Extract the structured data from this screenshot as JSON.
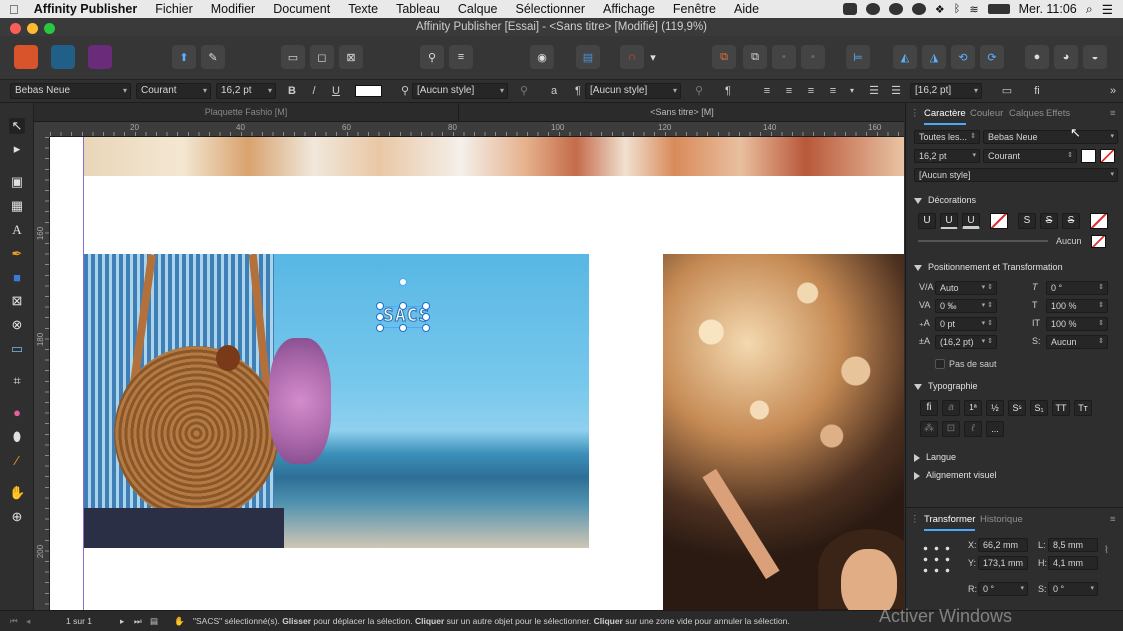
{
  "menubar": {
    "apple": "",
    "app_name": "Affinity Publisher",
    "items": [
      "Fichier",
      "Modifier",
      "Document",
      "Texte",
      "Tableau",
      "Calque",
      "Sélectionner",
      "Affichage",
      "Fenêtre",
      "Aide"
    ],
    "clock": "Mer. 11:06"
  },
  "window": {
    "title": "Affinity Publisher [Essai] - <Sans titre> [Modifié] (119,9%)"
  },
  "context_toolbar": {
    "font_family": "Bebas Neue",
    "font_style": "Courant",
    "font_size": "16,2 pt",
    "bold": "B",
    "italic": "/",
    "underline": "U",
    "char_style": "[Aucun style]",
    "char_a": "a",
    "pilcrow": "¶",
    "para_style": "[Aucun style]",
    "pilcrow2": "¶",
    "leading": "[16,2 pt]",
    "fi": "fi"
  },
  "doc_tabs": [
    "Plaquette Fashio [M]",
    "<Sans titre> [M]"
  ],
  "rulers": {
    "h_labels": [
      "20",
      "40",
      "60",
      "80",
      "100",
      "120",
      "140",
      "160"
    ],
    "v_labels": [
      "160",
      "180",
      "200"
    ]
  },
  "canvas": {
    "selected_text": "SACS"
  },
  "panel_tabs": [
    "Caractère",
    "Couleur",
    "Calques",
    "Effets"
  ],
  "character": {
    "scope": "Toutes les...",
    "font": "Bebas Neue",
    "size": "16,2 pt",
    "style": "Courant",
    "char_style": "[Aucun style]"
  },
  "decorations": {
    "title": "Décorations",
    "btns": [
      "U",
      "U",
      "U",
      "S",
      "S",
      "S"
    ],
    "line_value": "Aucun"
  },
  "position": {
    "title": "Positionnement et Transformation",
    "fields": [
      "Auto",
      "0 °",
      "0 ‰",
      "100 %",
      "0 pt",
      "100 %",
      "(16,2 pt)",
      "Aucun"
    ],
    "no_break": "Pas de saut"
  },
  "typography": {
    "title": "Typographie",
    "btns": [
      "fi",
      "a",
      "1ª",
      "½",
      "Sˢ",
      "S₁",
      "TT",
      "Tт"
    ],
    "more": "..."
  },
  "sections": {
    "langue": "Langue",
    "alignement": "Alignement visuel"
  },
  "transform_tabs": [
    "Transformer",
    "Historique"
  ],
  "transform": {
    "x_label": "X:",
    "x": "66,2 mm",
    "y_label": "Y:",
    "y": "173,1 mm",
    "l_label": "L:",
    "l": "8,5 mm",
    "h_label": "H:",
    "h": "4,1 mm",
    "r_label": "R:",
    "r": "0 °",
    "s_label": "S:",
    "s": "0 °"
  },
  "status": {
    "page": "1 sur 1",
    "msg1": "\"SACS\" sélectionné(s). ",
    "b1": "Glisser",
    "msg2": " pour déplacer la sélection. ",
    "b2": "Cliquer",
    "msg3": " sur un autre objet pour le sélectionner. ",
    "b3": "Cliquer",
    "msg4": " sur une zone vide pour annuler la sélection."
  },
  "watermark": "Activer Windows"
}
